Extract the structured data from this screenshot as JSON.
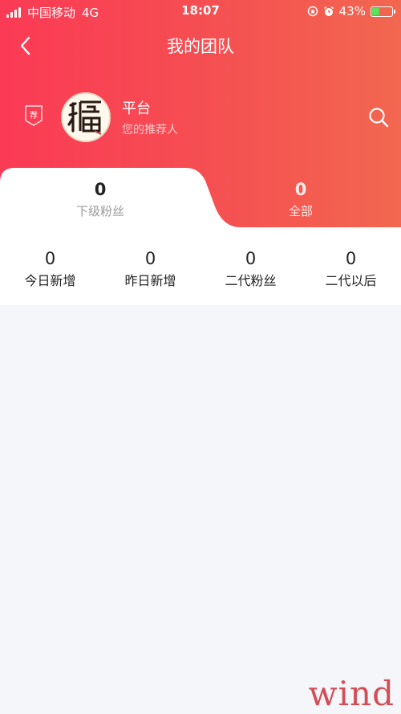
{
  "status_bar": {
    "carrier": "中国移动",
    "network": "4G",
    "time": "18:07",
    "battery": "43%",
    "battery_level": 0.43
  },
  "nav": {
    "title": "我的团队"
  },
  "profile": {
    "badge": "荐",
    "name": "平台",
    "subtitle": "您的推荐人"
  },
  "tabs": [
    {
      "count": "0",
      "label": "下级粉丝"
    },
    {
      "count": "0",
      "label": "全部"
    }
  ],
  "stats": [
    {
      "value": "0",
      "label": "今日新增"
    },
    {
      "value": "0",
      "label": "昨日新增"
    },
    {
      "value": "0",
      "label": "二代粉丝"
    },
    {
      "value": "0",
      "label": "二代以后"
    }
  ],
  "watermark": {
    "text": "wind"
  },
  "colors": {
    "header_start": "#fb3a55",
    "header_end": "#f2674f",
    "page_bg": "#f4f6f9"
  }
}
